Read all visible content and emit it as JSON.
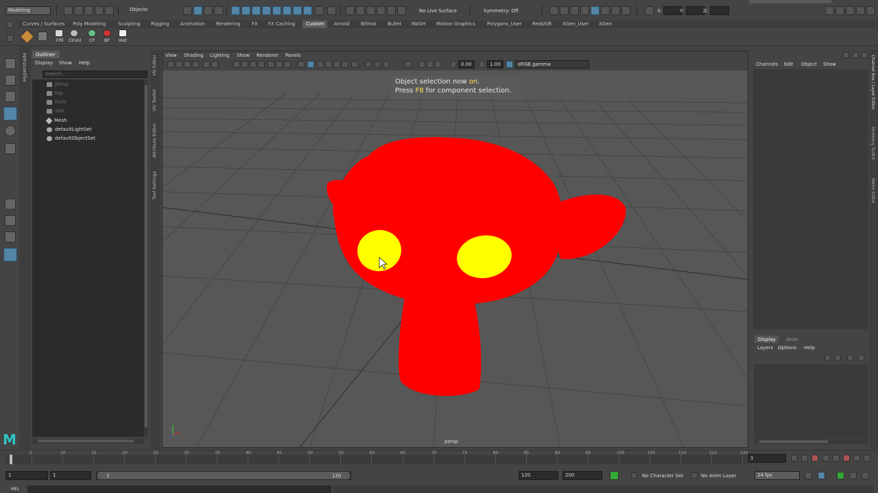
{
  "statusline": {
    "mode": "Modeling",
    "select_mode": "Objects",
    "live_surface": "No Live Surface",
    "symmetry": "Symmetry: Off",
    "x_label": "X:",
    "y_label": "Y:",
    "z_label": "Z:"
  },
  "shelf": {
    "tabs": [
      "Curves / Surfaces",
      "Poly Modeling",
      "Sculpting",
      "Rigging",
      "Animation",
      "Rendering",
      "FX",
      "FX Caching",
      "Custom",
      "Arnold",
      "Bifrost",
      "Bullet",
      "MASH",
      "Motion Graphics",
      "Polygons_User",
      "Redshift",
      "XGen_User",
      "XGen"
    ],
    "active_tab": "Custom",
    "buttons": [
      "FPE",
      "ClrUnl",
      "CP",
      "BP",
      "Hist"
    ]
  },
  "side_tabs": {
    "left": "Hypershade",
    "viewport_left": [
      "UV Editor",
      "UV Toolkit",
      "Attribute Editor",
      "Tool Settings"
    ],
    "right": [
      "Channel Box / Layer Editor",
      "Modeling Toolkit",
      "MASH Editor"
    ]
  },
  "outliner": {
    "title": "Outliner",
    "menu": [
      "Display",
      "Show",
      "Help"
    ],
    "search_placeholder": "Search...",
    "items": [
      {
        "label": "persp",
        "dim": true,
        "type": "camera"
      },
      {
        "label": "top",
        "dim": true,
        "type": "camera"
      },
      {
        "label": "front",
        "dim": true,
        "type": "camera"
      },
      {
        "label": "side",
        "dim": true,
        "type": "camera"
      },
      {
        "label": "Mesh",
        "dim": false,
        "type": "mesh"
      },
      {
        "label": "defaultLightSet",
        "dim": false,
        "type": "set"
      },
      {
        "label": "defaultObjectSet",
        "dim": false,
        "type": "set"
      }
    ]
  },
  "viewport": {
    "menu": [
      "View",
      "Shading",
      "Lighting",
      "Show",
      "Renderer",
      "Panels"
    ],
    "value1": "0.00",
    "value2": "1.00",
    "color_space": "sRGB gamma",
    "camera_label": "persp",
    "hud_line1_a": "Object selection now ",
    "hud_line1_b": "on",
    "hud_line1_c": ".",
    "hud_line2_a": "Press ",
    "hud_line2_b": "F8",
    "hud_line2_c": " for component selection."
  },
  "channel_box": {
    "menu": [
      "Channels",
      "Edit",
      "Object",
      "Show"
    ]
  },
  "layer_editor": {
    "tabs": [
      "Display",
      "Anim"
    ],
    "menu": [
      "Layers",
      "Options",
      "Help"
    ]
  },
  "timeline": {
    "ticks": [
      "5",
      "10",
      "15",
      "20",
      "25",
      "30",
      "35",
      "40",
      "45",
      "50",
      "55",
      "60",
      "65",
      "70",
      "75",
      "80",
      "85",
      "90",
      "95",
      "100",
      "105",
      "110",
      "115",
      "120"
    ],
    "current_frame": "1"
  },
  "range": {
    "start": "1",
    "playback_start": "1",
    "range_left": "1",
    "range_right": "120",
    "playback_end": "120",
    "end": "200",
    "character_set": "No Character Set",
    "anim_layer": "No Anim Layer",
    "fps": "24 fps"
  },
  "command_line": {
    "label": "MEL"
  },
  "colors": {
    "mesh": "#ff0000",
    "eyes": "#ffff00",
    "accent": "#5285a6"
  }
}
